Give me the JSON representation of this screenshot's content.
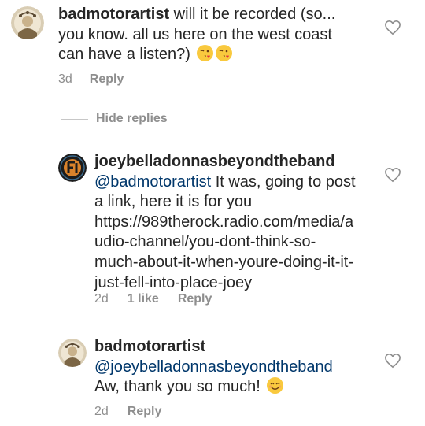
{
  "comments": [
    {
      "username": "badmotorartist",
      "text": " will it be recorded (so... you know. all us here on the west coast can have a listen?) ",
      "time": "3d",
      "reply_label": "Reply"
    }
  ],
  "hide_replies_label": "Hide replies",
  "replies": [
    {
      "username": "joeybelladonnasbeyondtheband",
      "mention": "@badmotorartist",
      "text": " It was, going to post a link, here it is for you https://989therock.radio.com/media/audio-channel/you-dont-think-so-much-about-it-when-youre-doing-it-it-just-fell-into-place-joey",
      "time": "2d",
      "likes": "1 like",
      "reply_label": "Reply"
    },
    {
      "username": "badmotorartist",
      "mention": "@joeybelladonnasbeyondtheband",
      "text": "Aw, thank you so much! ",
      "time": "2d",
      "reply_label": "Reply"
    }
  ],
  "icons": {
    "like": "heart-outline-icon",
    "kiss_emoji": "face-blowing-kiss-emoji",
    "smile_emoji": "smiling-face-emoji"
  },
  "colors": {
    "text": "#262626",
    "secondary": "#8e8e8e",
    "mention": "#00376b"
  }
}
